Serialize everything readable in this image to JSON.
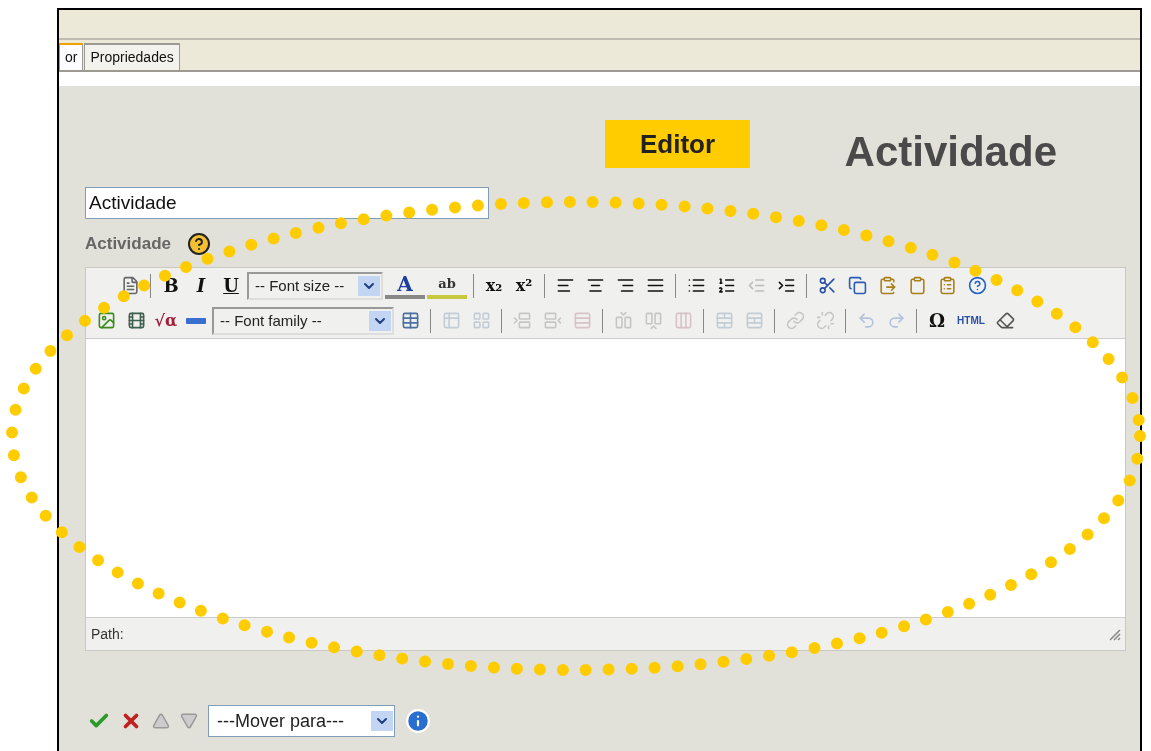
{
  "tabs": [
    {
      "label": "or",
      "selected": true
    },
    {
      "label": "Propriedades",
      "selected": false
    }
  ],
  "annotation": {
    "label": "Editor"
  },
  "heading": "Actividade",
  "title_field": {
    "value": "Actividade"
  },
  "field_label": "Actividade",
  "toolbar": {
    "row_1": [
      {
        "kind": "button",
        "disabled": false
      },
      {
        "kind": "separator"
      },
      {
        "kind": "text",
        "label": "B",
        "disabled": false
      },
      {
        "kind": "text",
        "label": "I",
        "disabled": false
      },
      {
        "kind": "text",
        "label": "U",
        "disabled": false
      },
      {
        "kind": "select",
        "value": "-- Font size --"
      },
      {
        "kind": "split",
        "label": "A",
        "disabled": false
      },
      {
        "kind": "split",
        "label": "ab",
        "disabled": false
      },
      {
        "kind": "separator"
      },
      {
        "kind": "text",
        "label": "x₂",
        "disabled": false
      },
      {
        "kind": "text",
        "label": "x²",
        "disabled": false
      },
      {
        "kind": "separator"
      },
      {
        "kind": "button",
        "disabled": false
      },
      {
        "kind": "button",
        "disabled": false
      },
      {
        "kind": "button",
        "disabled": false
      },
      {
        "kind": "button",
        "disabled": false
      },
      {
        "kind": "separator"
      },
      {
        "kind": "button",
        "disabled": false
      },
      {
        "kind": "button",
        "disabled": false
      },
      {
        "kind": "button",
        "disabled": true
      },
      {
        "kind": "button",
        "disabled": false
      },
      {
        "kind": "separator"
      },
      {
        "kind": "button",
        "disabled": false
      },
      {
        "kind": "button",
        "disabled": false
      },
      {
        "kind": "button",
        "disabled": false
      },
      {
        "kind": "button",
        "disabled": false
      },
      {
        "kind": "button",
        "disabled": false
      },
      {
        "kind": "button",
        "disabled": false
      }
    ],
    "row_2": [
      {
        "kind": "button",
        "disabled": false
      },
      {
        "kind": "button",
        "disabled": false
      },
      {
        "kind": "text",
        "label": "√α",
        "disabled": false
      },
      {
        "kind": "button",
        "disabled": false
      },
      {
        "kind": "select",
        "value": "-- Font family --"
      },
      {
        "kind": "button",
        "disabled": false
      },
      {
        "kind": "separator"
      },
      {
        "kind": "button",
        "disabled": true
      },
      {
        "kind": "button",
        "disabled": true
      },
      {
        "kind": "separator"
      },
      {
        "kind": "button",
        "disabled": true
      },
      {
        "kind": "button",
        "disabled": true
      },
      {
        "kind": "button",
        "disabled": true
      },
      {
        "kind": "separator"
      },
      {
        "kind": "button",
        "disabled": true
      },
      {
        "kind": "button",
        "disabled": true
      },
      {
        "kind": "button",
        "disabled": true
      },
      {
        "kind": "separator"
      },
      {
        "kind": "button",
        "disabled": true
      },
      {
        "kind": "button",
        "disabled": true
      },
      {
        "kind": "separator"
      },
      {
        "kind": "button",
        "disabled": true
      },
      {
        "kind": "button",
        "disabled": true
      },
      {
        "kind": "separator"
      },
      {
        "kind": "button",
        "disabled": true
      },
      {
        "kind": "button",
        "disabled": true
      },
      {
        "kind": "separator"
      },
      {
        "kind": "text",
        "label": "Ω",
        "disabled": false
      },
      {
        "kind": "text",
        "label": "HTML",
        "disabled": false
      },
      {
        "kind": "button",
        "disabled": false
      }
    ]
  },
  "path_label": "Path:",
  "actions": {
    "move_up": {
      "disabled": true
    },
    "move_down": {
      "disabled": true
    },
    "move_select": {
      "value": "---Mover para---"
    }
  }
}
